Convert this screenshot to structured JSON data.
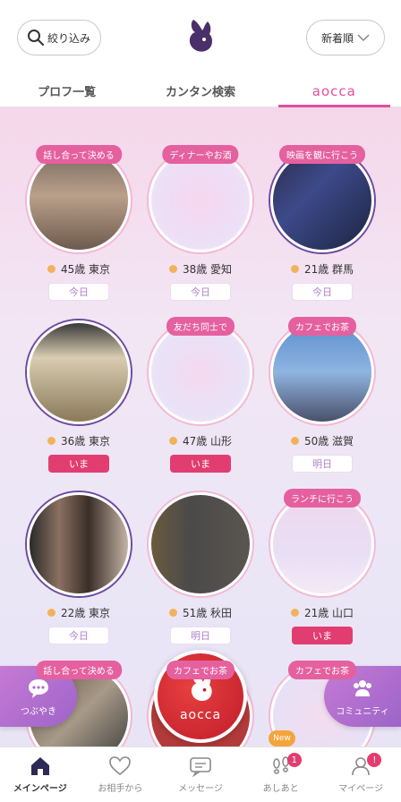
{
  "header": {
    "search_label": "絞り込み",
    "sort_label": "新着順"
  },
  "tabs": [
    {
      "label": "プロフ一覧",
      "active": false
    },
    {
      "label": "カンタン検索",
      "active": false
    },
    {
      "label": "aocca",
      "active": true
    }
  ],
  "profiles": [
    {
      "tag": "話し合って決める",
      "age_location": "45歳 東京",
      "status": "今日",
      "status_type": "today"
    },
    {
      "tag": "ディナーやお酒",
      "age_location": "38歳 愛知",
      "status": "今日",
      "status_type": "today"
    },
    {
      "tag": "映画を観に行こう",
      "age_location": "21歳 群馬",
      "status": "今日",
      "status_type": "today"
    },
    {
      "tag": "",
      "age_location": "36歳 東京",
      "status": "いま",
      "status_type": "now"
    },
    {
      "tag": "友だち同士で",
      "age_location": "47歳 山形",
      "status": "いま",
      "status_type": "now"
    },
    {
      "tag": "カフェでお茶",
      "age_location": "50歳 滋賀",
      "status": "明日",
      "status_type": "tomorrow"
    },
    {
      "tag": "",
      "age_location": "22歳 東京",
      "status": "今日",
      "status_type": "today"
    },
    {
      "tag": "",
      "age_location": "51歳 秋田",
      "status": "明日",
      "status_type": "tomorrow"
    },
    {
      "tag": "ランチに行こう",
      "age_location": "21歳 山口",
      "status": "いま",
      "status_type": "now"
    },
    {
      "tag": "話し合って決める",
      "age_location": "",
      "status": "",
      "status_type": ""
    },
    {
      "tag": "カフェでお茶",
      "age_location": "",
      "status": "",
      "status_type": ""
    },
    {
      "tag": "カフェでお茶",
      "age_location": "",
      "status": "",
      "status_type": ""
    }
  ],
  "floating": {
    "left_label": "つぶやき",
    "center_label": "aocca",
    "right_label": "コミュニティ",
    "new_badge": "New"
  },
  "bottom_nav": [
    {
      "label": "メインページ",
      "icon": "home-icon",
      "active": true,
      "badge": ""
    },
    {
      "label": "お相手から",
      "icon": "heart-icon",
      "active": false,
      "badge": ""
    },
    {
      "label": "メッセージ",
      "icon": "message-icon",
      "active": false,
      "badge": ""
    },
    {
      "label": "あしあと",
      "icon": "footprint-icon",
      "active": false,
      "badge": "1"
    },
    {
      "label": "マイページ",
      "icon": "mypage-icon",
      "active": false,
      "badge": "!"
    }
  ],
  "colors": {
    "accent": "#e24f9e",
    "now": "#e23d71",
    "tag": "#e5609f",
    "brand_dark": "#4a2f6b"
  }
}
